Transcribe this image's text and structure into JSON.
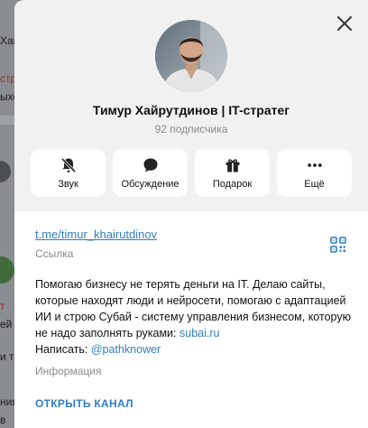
{
  "background": {
    "lines": [
      "Хай",
      "стр",
      "ыхо",
      "т",
      "ей",
      "и та",
      "ния",
      "в"
    ]
  },
  "profile": {
    "name": "Тимур Хайрутдинов | IT-стратег",
    "subscribers": "92 подписчика"
  },
  "actions": [
    {
      "label": "Звук",
      "icon": "mute-bell-icon"
    },
    {
      "label": "Обсуждение",
      "icon": "chat-bubble-icon"
    },
    {
      "label": "Подарок",
      "icon": "gift-icon"
    },
    {
      "label": "Ещё",
      "icon": "more-dots-icon"
    }
  ],
  "info": {
    "link": "t.me/timur_khairutdinov",
    "link_label": "Ссылка",
    "bio_text": "Помогаю бизнесу не терять деньги на IT. Делаю сайты, которые находят люди и нейросети, помогаю с адаптацией ИИ и строю Субай - систему управления бизнесом, которую не надо заполнять руками: ",
    "bio_site": "subai.ru",
    "bio_write_prefix": "Написать: ",
    "bio_handle": "@pathknower",
    "bio_label": "Информация",
    "open_channel": "ОТКРЫТЬ КАНАЛ"
  },
  "colors": {
    "accent": "#2f7ec0",
    "panel": "#f1f1f1",
    "card": "#ffffff"
  }
}
